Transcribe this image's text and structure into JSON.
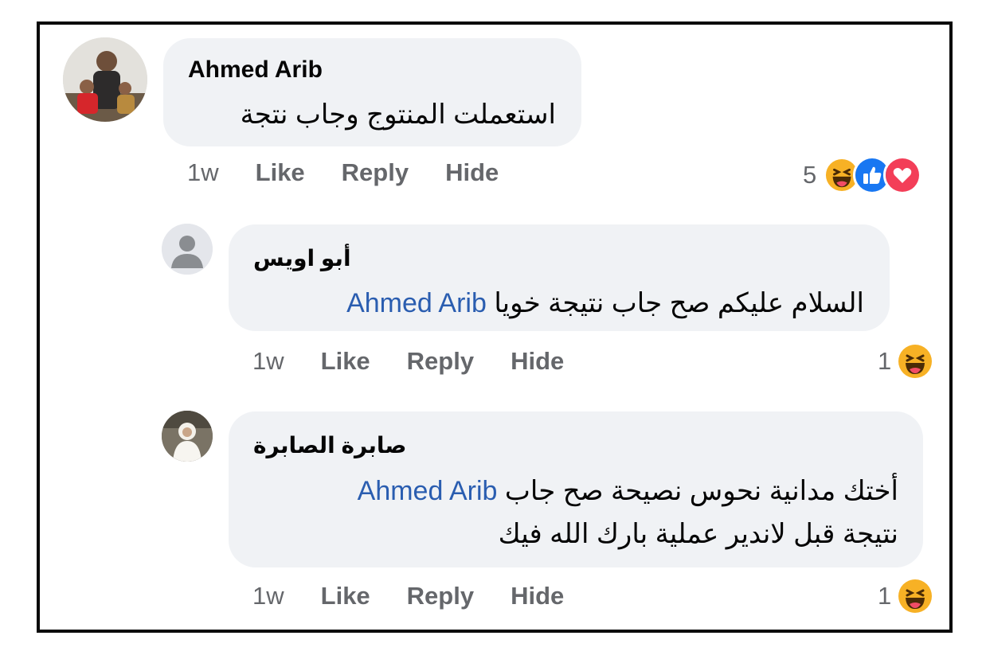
{
  "comments": [
    {
      "author": "Ahmed Arib",
      "text": "استعملت المنتوج وجاب نتجة",
      "time": "1w",
      "actions": [
        "Like",
        "Reply",
        "Hide"
      ],
      "reaction_count": "5",
      "reaction_icons": [
        "haha-icon",
        "like-icon",
        "love-icon"
      ]
    },
    {
      "author": "أبو اويس",
      "mention": "Ahmed Arib",
      "text": "السلام عليكم صح جاب نتيجة خويا",
      "time": "1w",
      "actions": [
        "Like",
        "Reply",
        "Hide"
      ],
      "reaction_count": "1",
      "reaction_icons": [
        "haha-icon"
      ]
    },
    {
      "author": "صابرة الصابرة",
      "mention": "Ahmed Arib",
      "text_line1": "أختك مدانية نحوس نصيحة صح جاب",
      "text_line2": "نتيجة قبل لاندير عملية بارك الله فيك",
      "time": "1w",
      "actions": [
        "Like",
        "Reply",
        "Hide"
      ],
      "reaction_count": "1",
      "reaction_icons": [
        "haha-icon"
      ]
    }
  ],
  "colors": {
    "bubble": "#f0f2f5",
    "mention": "#2a5db0",
    "meta": "#65676b",
    "like_blue": "#1877f2",
    "love_red": "#f33e58",
    "haha_yellow": "#f7b125"
  }
}
